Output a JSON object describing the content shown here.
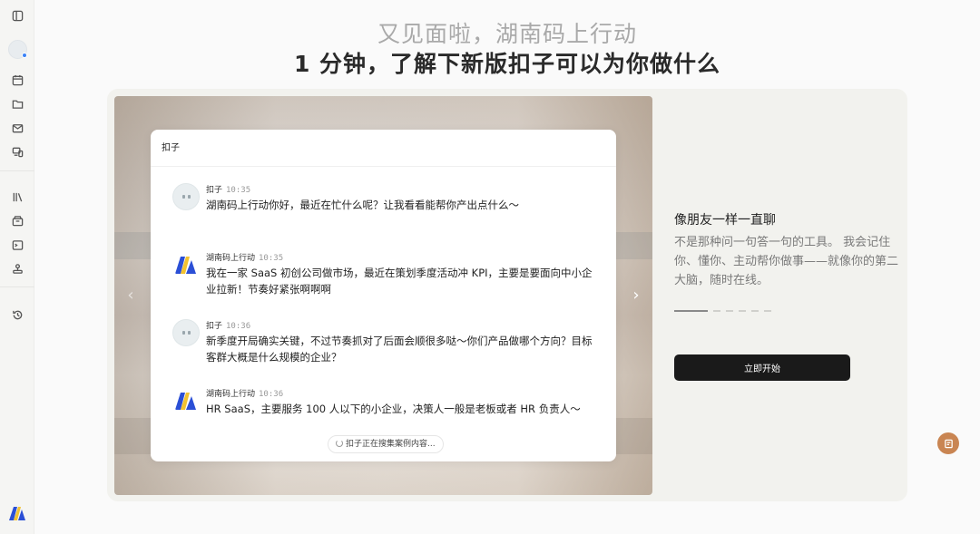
{
  "heading": {
    "line1": "又见面啦，湖南码上行动",
    "line2": "1 分钟，了解下新版扣子可以为你做什么"
  },
  "sidebar": {
    "icons": [
      "sidebar-toggle-icon",
      "calendar-icon",
      "folder-icon",
      "mail-icon",
      "devices-icon",
      "library-icon",
      "archive-icon",
      "terminal-icon",
      "plugin-icon",
      "history-icon"
    ]
  },
  "chat": {
    "title": "扣子",
    "messages": [
      {
        "sender": "扣子",
        "time": "10:35",
        "role": "bot",
        "text": "湖南码上行动你好，最近在忙什么呢？让我看看能帮你产出点什么～"
      },
      {
        "sender": "湖南码上行动",
        "time": "10:35",
        "role": "user",
        "text": "我在一家 SaaS 初创公司做市场，最近在策划季度活动冲 KPI，主要是要面向中小企业拉新！节奏好紧张啊啊啊"
      },
      {
        "sender": "扣子",
        "time": "10:36",
        "role": "bot",
        "text": "新季度开局确实关键，不过节奏抓对了后面会顺很多哒～你们产品做哪个方向？目标客群大概是什么规模的企业？"
      },
      {
        "sender": "湖南码上行动",
        "time": "10:36",
        "role": "user",
        "text": "HR SaaS，主要服务 100 人以下的小企业，决策人一般是老板或者 HR 负责人～"
      }
    ],
    "status": "扣子正在搜集案例内容..."
  },
  "feature": {
    "title": "像朋友一样一直聊",
    "description": "不是那种问一句答一句的工具。 我会记住你、懂你、主动帮你做事——就像你的第二大脑，随时在线。",
    "page_count": 6,
    "active_page": 1
  },
  "actions": {
    "start_label": "立即开始"
  },
  "colors": {
    "accent": "#c98552",
    "primary_button": "#1a1a1a",
    "status_dot": "#3b82f6"
  }
}
